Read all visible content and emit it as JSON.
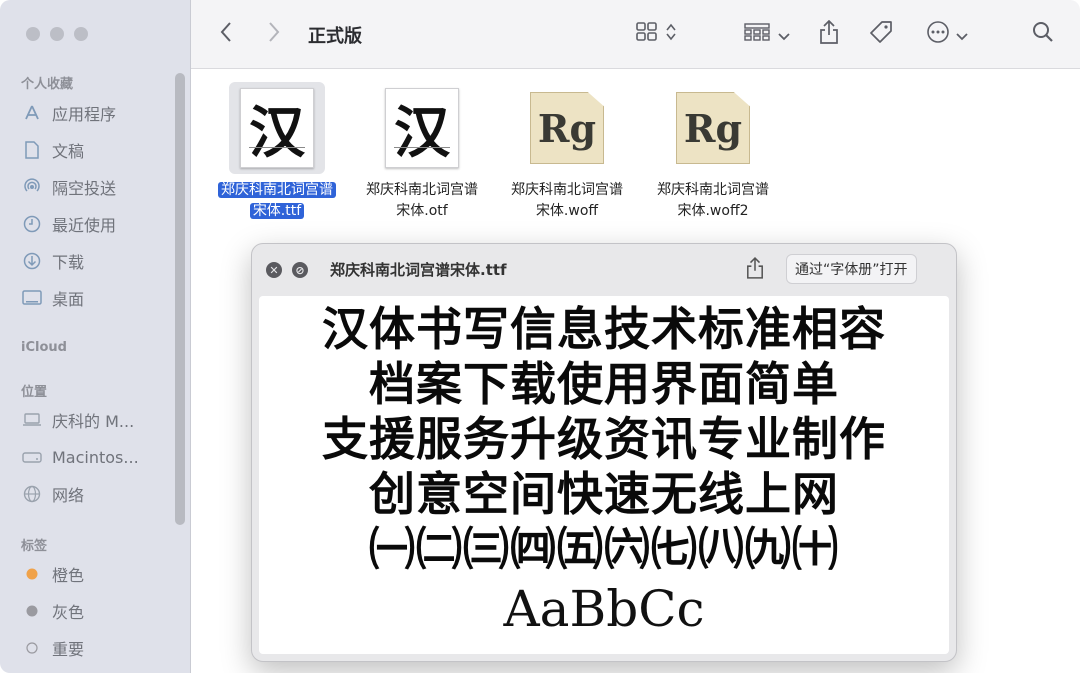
{
  "window": {
    "title": "正式版"
  },
  "sidebar": {
    "sections": {
      "favorites": "个人收藏",
      "icloud": "iCloud",
      "locations": "位置",
      "tags": "标签"
    },
    "favorites": [
      {
        "label": "应用程序",
        "icon": "applications-icon"
      },
      {
        "label": "文稿",
        "icon": "document-icon"
      },
      {
        "label": "隔空投送",
        "icon": "airdrop-icon"
      },
      {
        "label": "最近使用",
        "icon": "clock-icon"
      },
      {
        "label": "下载",
        "icon": "download-icon"
      },
      {
        "label": "桌面",
        "icon": "desktop-icon"
      }
    ],
    "locations": [
      {
        "label": "庆科的 M...",
        "icon": "laptop-icon"
      },
      {
        "label": "Macintos...",
        "icon": "disk-icon"
      },
      {
        "label": "网络",
        "icon": "globe-icon"
      }
    ],
    "tags": [
      {
        "label": "橙色",
        "color": "#f0a24a"
      },
      {
        "label": "灰色",
        "color": "#9a9aa0"
      },
      {
        "label": "重要",
        "color": "none"
      }
    ]
  },
  "toolbar": {
    "back_icon": "chevron-left-icon",
    "forward_icon": "chevron-right-icon",
    "view_icon": "grid-view-icon",
    "group_icon": "group-icon",
    "share_icon": "share-icon",
    "tag_icon": "tag-icon",
    "more_icon": "more-icon",
    "search_icon": "search-icon"
  },
  "files": [
    {
      "name_line1": "郑庆科南北词宫谱",
      "name_line2": "宋体.ttf",
      "thumb": "汉",
      "kind": "ttf",
      "selected": true
    },
    {
      "name_line1": "郑庆科南北词宫谱",
      "name_line2": "宋体.otf",
      "thumb": "汉",
      "kind": "ttf",
      "selected": false
    },
    {
      "name_line1": "郑庆科南北词宫谱",
      "name_line2": "宋体.woff",
      "thumb": "Rg",
      "kind": "woff",
      "selected": false
    },
    {
      "name_line1": "郑庆科南北词宫谱",
      "name_line2": "宋体.woff2",
      "thumb": "Rg",
      "kind": "woff",
      "selected": false
    }
  ],
  "preview": {
    "title": "郑庆科南北词宫谱宋体.ttf",
    "open_button": "通过“字体册”打开",
    "lines": [
      "汉体书写信息技术标准相容",
      "档案下载使用界面简单",
      "支援服务升级资讯专业制作",
      "创意空间快速无线上网",
      "㈠㈡㈢㈣㈤㈥㈦㈧㈨㈩",
      "AaBbCc"
    ]
  }
}
